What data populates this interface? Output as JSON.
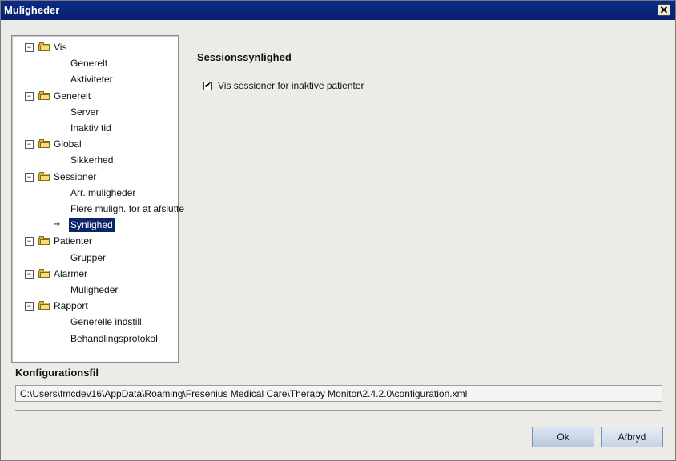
{
  "window": {
    "title": "Muligheder",
    "close": "✕"
  },
  "tree": {
    "groups": [
      {
        "label": "Vis",
        "children": [
          "Generelt",
          "Aktiviteter"
        ]
      },
      {
        "label": "Generelt",
        "children": [
          "Server",
          "Inaktiv tid"
        ]
      },
      {
        "label": "Global",
        "children": [
          "Sikkerhed"
        ]
      },
      {
        "label": "Sessioner",
        "children": [
          "Arr. muligheder",
          "Flere muligh. for at afslutte",
          "Synlighed"
        ]
      },
      {
        "label": "Patienter",
        "children": [
          "Grupper"
        ]
      },
      {
        "label": "Alarmer",
        "children": [
          "Muligheder"
        ]
      },
      {
        "label": "Rapport",
        "children": [
          "Generelle indstill.",
          "Behandlingsprotokol"
        ]
      }
    ],
    "expander_symbol": "−",
    "selected_item": "Synlighed"
  },
  "panel": {
    "title": "Sessionssynlighed",
    "checkbox_label": "Vis sessioner for inaktive patienter",
    "checkbox_checked": true,
    "checkmark": "✔"
  },
  "config": {
    "title": "Konfigurationsfil",
    "path": "C:\\Users\\fmcdev16\\AppData\\Roaming\\Fresenius Medical Care\\Therapy Monitor\\2.4.2.0\\configuration.xml"
  },
  "buttons": {
    "ok": "Ok",
    "cancel": "Afbryd"
  },
  "colors": {
    "titlebar": "#0c2b86",
    "selection": "#0a246a",
    "folder": "#f5de7a"
  }
}
